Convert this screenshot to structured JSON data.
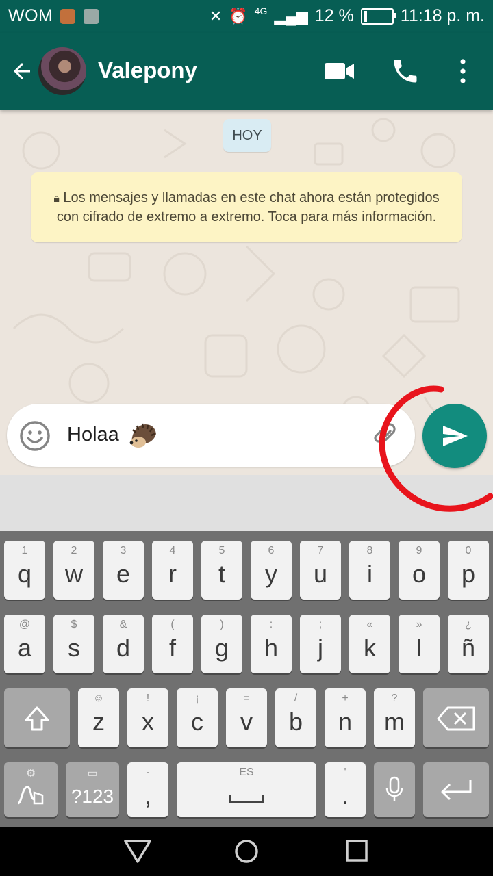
{
  "status_bar": {
    "carrier": "WOM",
    "network": "4G",
    "battery": "12 %",
    "battery_level": 0.12,
    "time": "11:18 p. m."
  },
  "header": {
    "contact_name": "Valepony",
    "icons": [
      "arrow-back-icon",
      "video-call-icon",
      "phone-icon",
      "more-vertical-icon"
    ]
  },
  "chat": {
    "date_chip": "HOY",
    "encryption_notice": "Los mensajes y llamadas en este chat ahora están protegidos con cifrado de extremo a extremo. Toca para más información."
  },
  "composer": {
    "text": "Holaa",
    "emoji": "hedgehog"
  },
  "keyboard": {
    "row1": [
      {
        "hint": "1",
        "key": "q"
      },
      {
        "hint": "2",
        "key": "w"
      },
      {
        "hint": "3",
        "key": "e"
      },
      {
        "hint": "4",
        "key": "r"
      },
      {
        "hint": "5",
        "key": "t"
      },
      {
        "hint": "6",
        "key": "y"
      },
      {
        "hint": "7",
        "key": "u"
      },
      {
        "hint": "8",
        "key": "i"
      },
      {
        "hint": "9",
        "key": "o"
      },
      {
        "hint": "0",
        "key": "p"
      }
    ],
    "row2": [
      {
        "hint": "@",
        "key": "a"
      },
      {
        "hint": "$",
        "key": "s"
      },
      {
        "hint": "&",
        "key": "d"
      },
      {
        "hint": "(",
        "key": "f"
      },
      {
        "hint": ")",
        "key": "g"
      },
      {
        "hint": ":",
        "key": "h"
      },
      {
        "hint": ";",
        "key": "j"
      },
      {
        "hint": "«",
        "key": "k"
      },
      {
        "hint": "»",
        "key": "l"
      },
      {
        "hint": "¿",
        "key": "ñ"
      }
    ],
    "row3": [
      {
        "hint": "",
        "key": "z"
      },
      {
        "hint": "!",
        "key": "x"
      },
      {
        "hint": "¡",
        "key": "c"
      },
      {
        "hint": "=",
        "key": "v"
      },
      {
        "hint": "/",
        "key": "b"
      },
      {
        "hint": "+",
        "key": "n"
      },
      {
        "hint": "?",
        "key": "m"
      }
    ],
    "symbols_key": "?123",
    "comma_key": ",",
    "comma_hint": "-",
    "space_hint": "ES",
    "period_key": ".",
    "period_hint": "'"
  },
  "colors": {
    "header": "#075e54",
    "send_button": "#128c7e",
    "chat_bg": "#ece5dd",
    "notice_bg": "#fdf4c5",
    "annotation": "#e8141c"
  }
}
